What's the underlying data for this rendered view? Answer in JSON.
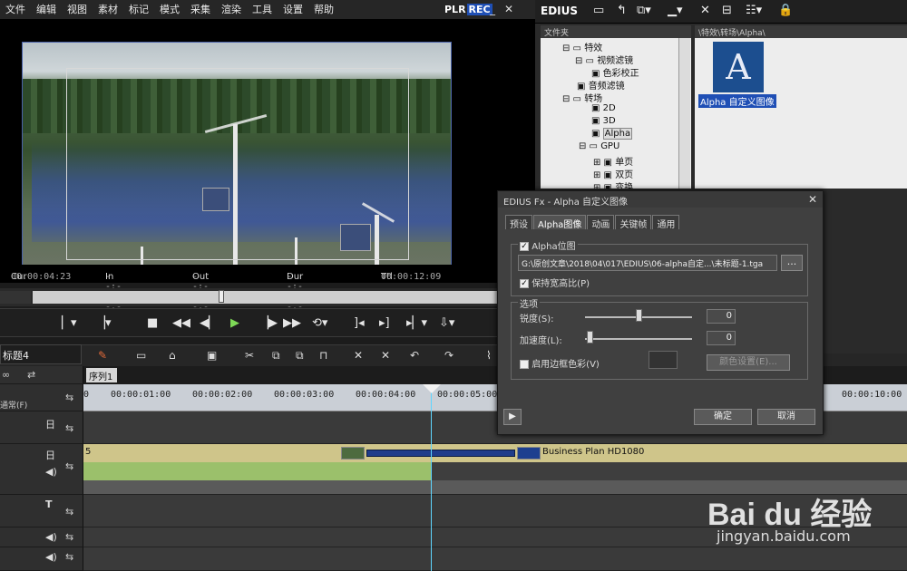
{
  "menu": [
    "文件",
    "编辑",
    "视图",
    "素材",
    "标记",
    "模式",
    "采集",
    "渲染",
    "工具",
    "设置",
    "帮助"
  ],
  "status_plr": "PLR",
  "status_rec": "REC",
  "window_buttons": [
    "_",
    "✕"
  ],
  "timecode": {
    "cur_label": "Cur",
    "cur_value": "00:00:04:23",
    "in_label": "In",
    "in_value": "--:--:--:--",
    "out_label": "Out",
    "out_value": "--:--:--:--",
    "dur_label": "Dur",
    "dur_value": "--:--:--:--",
    "ttl_label": "Ttl",
    "ttl_value": "00:00:12:09"
  },
  "sequence": {
    "name": "标题4",
    "tab": "序列1",
    "track_mode": "通常(F)"
  },
  "ruler": [
    "0",
    "00:00:01:00",
    "00:00:02:00",
    "00:00:03:00",
    "00:00:04:00",
    "00:00:05:00",
    "00:00:10:00"
  ],
  "clip": {
    "frame": "5",
    "label": "Business Plan HD1080"
  },
  "right_panel": {
    "app_name": "EDIUS",
    "folder_header": "文件夹",
    "path_header": "\\特效\\转场\\Alpha\\",
    "tree": [
      "特效",
      "视频滤镜",
      "色彩校正",
      "音频滤镜",
      "转场",
      "2D",
      "3D",
      "Alpha",
      "GPU",
      "单页",
      "双页",
      "变换"
    ],
    "effect_icon_letter": "A",
    "effect_label": "Alpha 自定义图像"
  },
  "dialog": {
    "title": "EDIUS Fx - Alpha 自定义图像",
    "tabs": [
      "预设",
      "Alpha图像",
      "动画",
      "关键帧",
      "通用"
    ],
    "alpha_map_label": "Alpha位图",
    "path_value": "G:\\原创文章\\2018\\04\\017\\EDIUS\\06-alpha自定...\\未标题-1.tga",
    "browse_label": "...",
    "keep_aspect_label": "保持宽高比(P)",
    "options_label": "选项",
    "sharpness_label": "锐度(S):",
    "sharpness_value": "0",
    "accel_label": "加速度(L):",
    "accel_value": "0",
    "border_label": "启用边框色彩(V)",
    "color_settings_label": "颜色设置(E)...",
    "ok_label": "确定",
    "cancel_label": "取消"
  },
  "watermark": {
    "main": "Bai du 经验",
    "sub": "jingyan.baidu.com"
  }
}
